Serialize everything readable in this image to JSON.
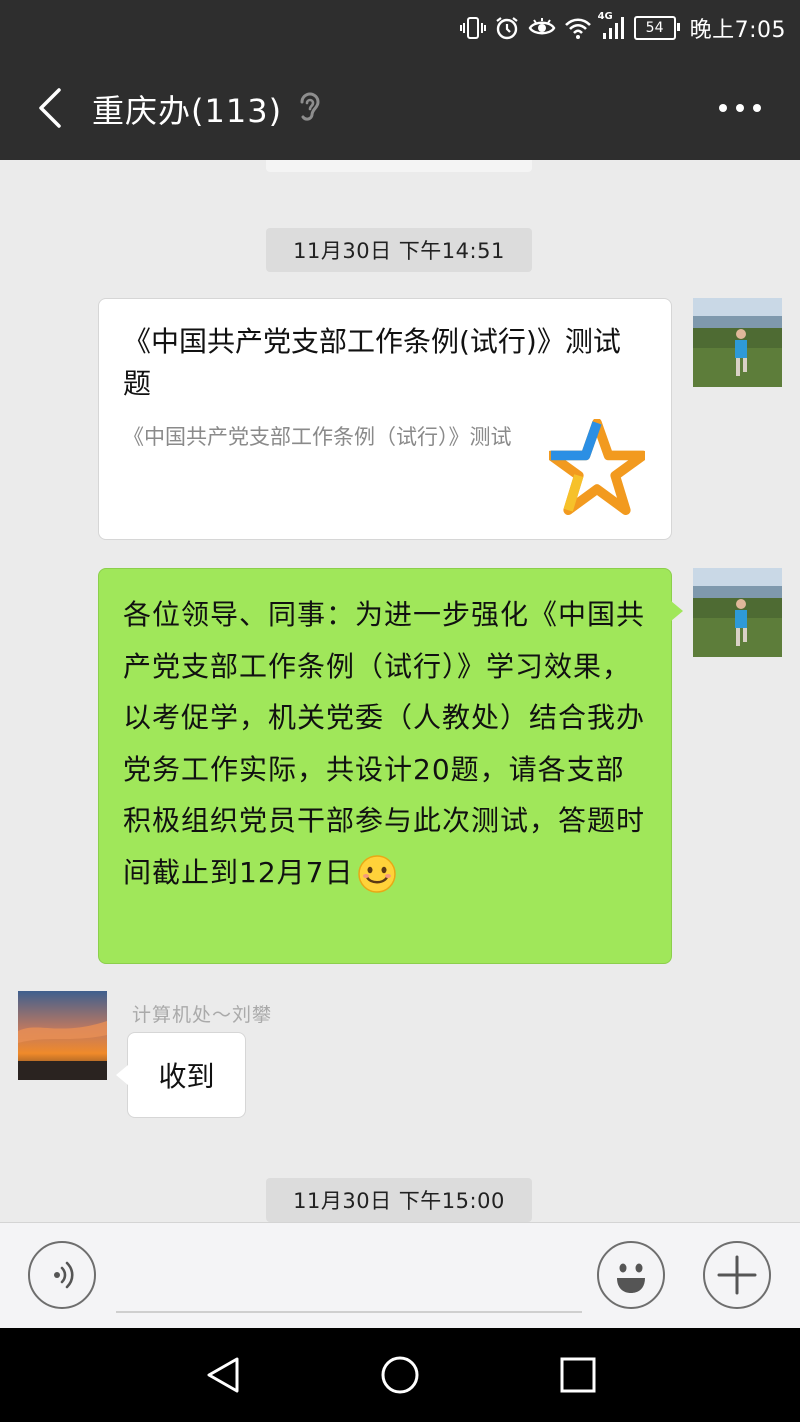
{
  "status_bar": {
    "network": "4G",
    "battery": "54",
    "time": "晚上7:05"
  },
  "header": {
    "title": "重庆办(113)",
    "icons": [
      "back-icon",
      "ear-icon",
      "more-icon"
    ]
  },
  "messages": {
    "timestamp_1": "11月30日 下午14:51",
    "card": {
      "title": "《中国共产党支部工作条例(试行)》测试题",
      "description": "《中国共产党支部工作条例（试行）》测试",
      "icon": "star-icon"
    },
    "green_text": "各位领导、同事：为进一步强化《中国共产党支部工作条例（试行）》学习效果，以考促学，机关党委（人教处）结合我办党务工作实际，共设计20题，请各支部积极组织党员干部参与此次测试，答题时间截止到12月7日",
    "incoming": {
      "sender": "计算机处～刘攀",
      "text": "收到"
    },
    "timestamp_2": "11月30日 下午15:00"
  },
  "input_bar": {
    "value": "",
    "icons": [
      "voice-icon",
      "emoji-icon",
      "plus-icon"
    ]
  },
  "nav_bar": {
    "icons": [
      "back-triangle-icon",
      "home-circle-icon",
      "recents-square-icon"
    ]
  },
  "colors": {
    "header_bg": "#2e2e2e",
    "chat_bg": "#ebebeb",
    "self_bubble": "#a0e75a",
    "other_bubble": "#ffffff"
  }
}
